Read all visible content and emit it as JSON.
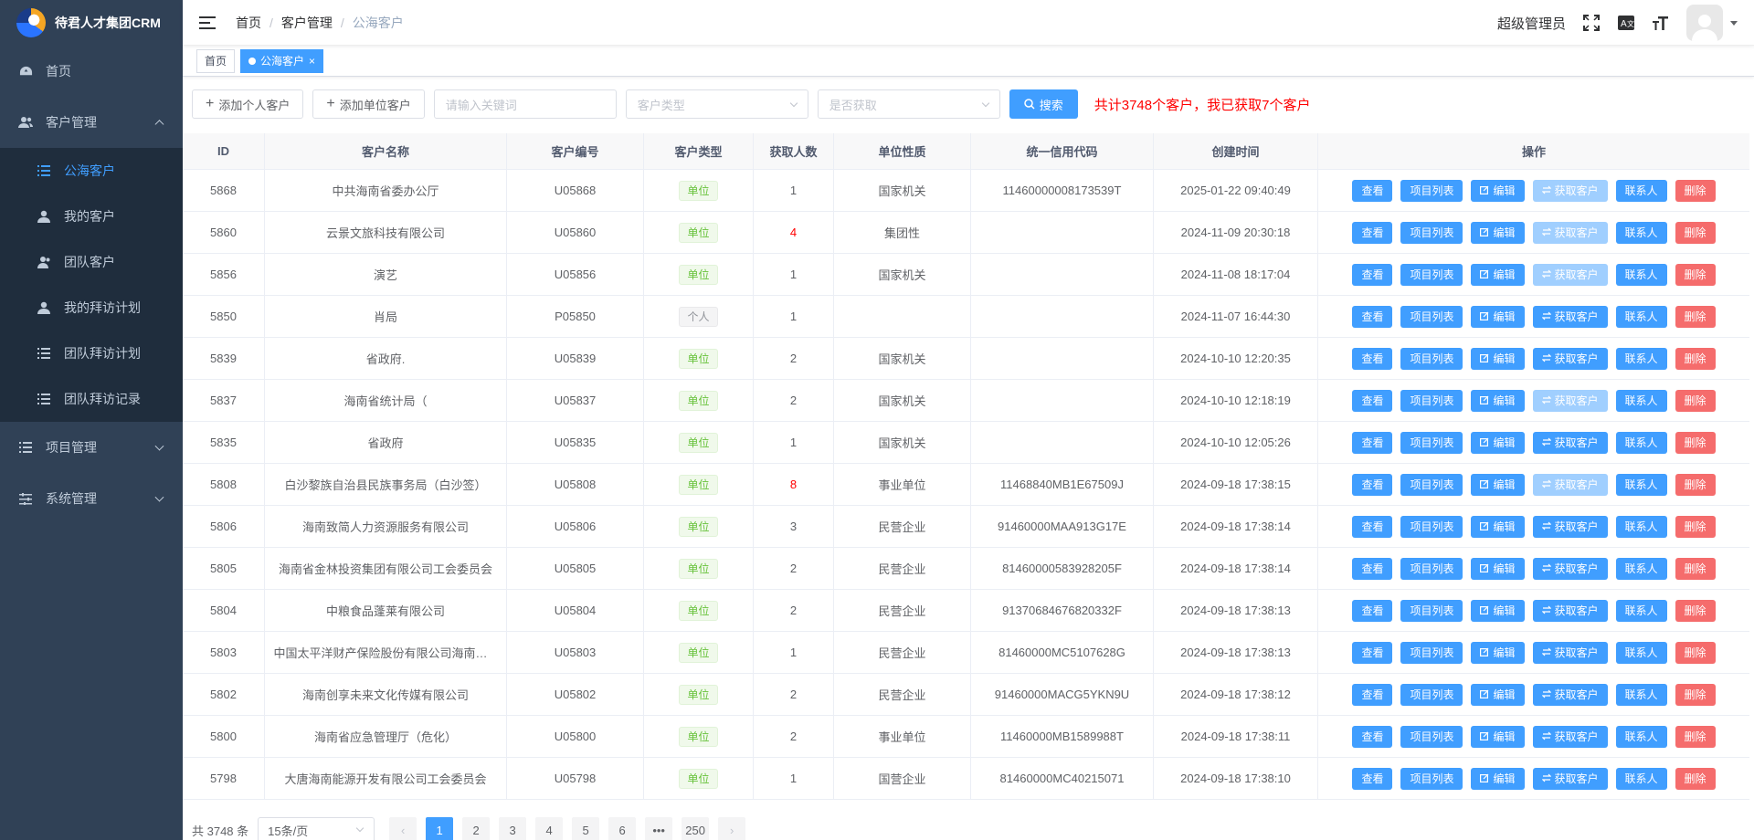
{
  "app": {
    "logo_text": "待君人才集团CRM"
  },
  "sidebar": {
    "items": [
      {
        "label": "首页",
        "icon": "dashboard-icon"
      },
      {
        "label": "客户管理",
        "icon": "users-icon",
        "expanded": true,
        "children": [
          {
            "label": "公海客户",
            "icon": "list-icon",
            "active": true
          },
          {
            "label": "我的客户",
            "icon": "user-icon"
          },
          {
            "label": "团队客户",
            "icon": "team-icon"
          },
          {
            "label": "我的拜访计划",
            "icon": "user-icon"
          },
          {
            "label": "团队拜访计划",
            "icon": "list-icon"
          },
          {
            "label": "团队拜访记录",
            "icon": "list-icon"
          }
        ]
      },
      {
        "label": "项目管理",
        "icon": "list-icon"
      },
      {
        "label": "系统管理",
        "icon": "settings-sliders-icon"
      }
    ]
  },
  "header": {
    "breadcrumb": [
      "首页",
      "客户管理",
      "公海客户"
    ],
    "username": "超级管理员"
  },
  "tags": [
    {
      "label": "首页",
      "active": false
    },
    {
      "label": "公海客户",
      "active": true,
      "close": "×"
    }
  ],
  "toolbar": {
    "add_person": "添加个人客户",
    "add_unit": "添加单位客户",
    "keyword_placeholder": "请输入关键词",
    "type_placeholder": "客户类型",
    "obtained_placeholder": "是否获取",
    "search": "搜索",
    "summary": "共计3748个客户，我已获取7个客户"
  },
  "table": {
    "headers": [
      "ID",
      "客户名称",
      "客户编号",
      "客户类型",
      "获取人数",
      "单位性质",
      "统一信用代码",
      "创建时间",
      "操作"
    ],
    "ops": {
      "view": "查看",
      "projects": "项目列表",
      "edit": "编辑",
      "obtain": "获取客户",
      "contacts": "联系人",
      "delete": "删除"
    },
    "rows": [
      {
        "id": "5868",
        "name": "中共海南省委办公厅",
        "code": "U05868",
        "type": "单位",
        "count": "1",
        "count_red": false,
        "nature": "国家机关",
        "usc": "11460000008173539T",
        "time": "2025-01-22 09:40:49",
        "obtain_disabled": true
      },
      {
        "id": "5860",
        "name": "云景文旅科技有限公司",
        "code": "U05860",
        "type": "单位",
        "count": "4",
        "count_red": true,
        "nature": "集团性",
        "usc": "",
        "time": "2024-11-09 20:30:18",
        "obtain_disabled": true
      },
      {
        "id": "5856",
        "name": "演艺",
        "code": "U05856",
        "type": "单位",
        "count": "1",
        "count_red": false,
        "nature": "国家机关",
        "usc": "",
        "time": "2024-11-08 18:17:04",
        "obtain_disabled": true
      },
      {
        "id": "5850",
        "name": "肖局",
        "code": "P05850",
        "type": "个人",
        "count": "1",
        "count_red": false,
        "nature": "",
        "usc": "",
        "time": "2024-11-07 16:44:30",
        "obtain_disabled": false
      },
      {
        "id": "5839",
        "name": "省政府.",
        "code": "U05839",
        "type": "单位",
        "count": "2",
        "count_red": false,
        "nature": "国家机关",
        "usc": "",
        "time": "2024-10-10 12:20:35",
        "obtain_disabled": false
      },
      {
        "id": "5837",
        "name": "海南省统计局（",
        "code": "U05837",
        "type": "单位",
        "count": "2",
        "count_red": false,
        "nature": "国家机关",
        "usc": "",
        "time": "2024-10-10 12:18:19",
        "obtain_disabled": true
      },
      {
        "id": "5835",
        "name": "省政府",
        "code": "U05835",
        "type": "单位",
        "count": "1",
        "count_red": false,
        "nature": "国家机关",
        "usc": "",
        "time": "2024-10-10 12:05:26",
        "obtain_disabled": false
      },
      {
        "id": "5808",
        "name": "白沙黎族自治县民族事务局（白沙签）",
        "code": "U05808",
        "type": "单位",
        "count": "8",
        "count_red": true,
        "nature": "事业单位",
        "usc": "11468840MB1E67509J",
        "time": "2024-09-18 17:38:15",
        "obtain_disabled": true
      },
      {
        "id": "5806",
        "name": "海南致简人力资源服务有限公司",
        "code": "U05806",
        "type": "单位",
        "count": "3",
        "count_red": false,
        "nature": "民营企业",
        "usc": "91460000MAA913G17E",
        "time": "2024-09-18 17:38:14",
        "obtain_disabled": false
      },
      {
        "id": "5805",
        "name": "海南省金林投资集团有限公司工会委员会",
        "code": "U05805",
        "type": "单位",
        "count": "2",
        "count_red": false,
        "nature": "民营企业",
        "usc": "81460000583928205F",
        "time": "2024-09-18 17:38:14",
        "obtain_disabled": false
      },
      {
        "id": "5804",
        "name": "中粮食品蓬莱有限公司",
        "code": "U05804",
        "type": "单位",
        "count": "2",
        "count_red": false,
        "nature": "民营企业",
        "usc": "91370684676820332F",
        "time": "2024-09-18 17:38:13",
        "obtain_disabled": false
      },
      {
        "id": "5803",
        "name": "中国太平洋财产保险股份有限公司海南分公司",
        "code": "U05803",
        "type": "单位",
        "count": "1",
        "count_red": false,
        "nature": "民营企业",
        "usc": "81460000MC5107628G",
        "time": "2024-09-18 17:38:13",
        "obtain_disabled": false
      },
      {
        "id": "5802",
        "name": "海南创享未来文化传媒有限公司",
        "code": "U05802",
        "type": "单位",
        "count": "2",
        "count_red": false,
        "nature": "民营企业",
        "usc": "91460000MACG5YKN9U",
        "time": "2024-09-18 17:38:12",
        "obtain_disabled": false
      },
      {
        "id": "5800",
        "name": "海南省应急管理厅（危化）",
        "code": "U05800",
        "type": "单位",
        "count": "2",
        "count_red": false,
        "nature": "事业单位",
        "usc": "11460000MB1589988T",
        "time": "2024-09-18 17:38:11",
        "obtain_disabled": false
      },
      {
        "id": "5798",
        "name": "大唐海南能源开发有限公司工会委员会",
        "code": "U05798",
        "type": "单位",
        "count": "1",
        "count_red": false,
        "nature": "国营企业",
        "usc": "81460000MC40215071",
        "time": "2024-09-18 17:38:10",
        "obtain_disabled": false
      }
    ]
  },
  "pagination": {
    "total": "共 3748 条",
    "page_size": "15条/页",
    "pages": [
      "1",
      "2",
      "3",
      "4",
      "5",
      "6",
      "•••",
      "250"
    ],
    "current": "1",
    "prev": "‹",
    "next": "›"
  },
  "colors": {
    "sidebar_bg": "#304156",
    "primary": "#409eff",
    "danger": "#f56c6c",
    "summary": "#ff0000"
  }
}
